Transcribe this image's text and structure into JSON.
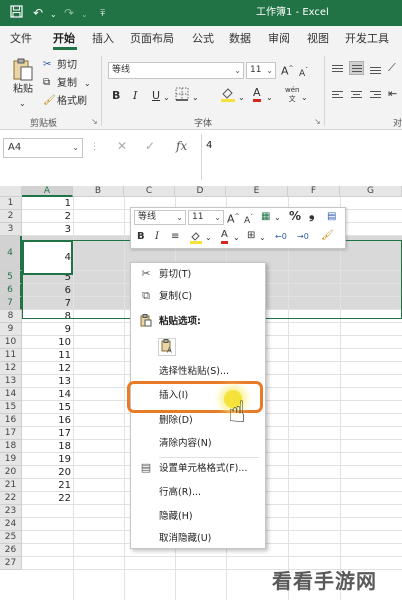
{
  "titlebar": {
    "title": "工作簿1 - Excel",
    "save_icon": "save-icon",
    "undo_icon": "undo-icon",
    "redo_icon": "redo-icon",
    "color": "#217346"
  },
  "tabs": [
    "文件",
    "开始",
    "插入",
    "页面布局",
    "公式",
    "数据",
    "审阅",
    "视图",
    "开发工具"
  ],
  "active_tab": "开始",
  "ribbon": {
    "clipboard": {
      "paste_label": "粘贴",
      "cut_label": "剪切",
      "copy_label": "复制",
      "format_painter_label": "格式刷",
      "group_label": "剪贴板"
    },
    "font": {
      "font_name": "等线",
      "font_size": "11",
      "grow": "A",
      "shrink": "A",
      "bold": "B",
      "italic": "I",
      "underline": "U",
      "font_color": "A",
      "wen": "wén",
      "group_label": "字体"
    },
    "alignment": {
      "group_label": "对"
    }
  },
  "formula_bar": {
    "name_box": "A4",
    "fx": "fx",
    "value": "4"
  },
  "columns": [
    "A",
    "B",
    "C",
    "D",
    "E",
    "F",
    "G"
  ],
  "rows": [
    {
      "n": "1",
      "a": "1"
    },
    {
      "n": "2",
      "a": "2"
    },
    {
      "n": "3",
      "a": "3"
    },
    {
      "n": "4",
      "a": "4"
    },
    {
      "n": "5",
      "a": "5"
    },
    {
      "n": "6",
      "a": "6"
    },
    {
      "n": "7",
      "a": "7"
    },
    {
      "n": "8",
      "a": "8"
    },
    {
      "n": "9",
      "a": "9"
    },
    {
      "n": "10",
      "a": "10"
    },
    {
      "n": "11",
      "a": "11"
    },
    {
      "n": "12",
      "a": "12"
    },
    {
      "n": "13",
      "a": "13"
    },
    {
      "n": "14",
      "a": "14"
    },
    {
      "n": "15",
      "a": "15"
    },
    {
      "n": "16",
      "a": "16"
    },
    {
      "n": "17",
      "a": "17"
    },
    {
      "n": "18",
      "a": "18"
    },
    {
      "n": "19",
      "a": "19"
    },
    {
      "n": "20",
      "a": "20"
    },
    {
      "n": "21",
      "a": "21"
    },
    {
      "n": "22",
      "a": "22"
    },
    {
      "n": "23",
      "a": ""
    },
    {
      "n": "24",
      "a": ""
    },
    {
      "n": "25",
      "a": ""
    },
    {
      "n": "26",
      "a": ""
    },
    {
      "n": "27",
      "a": ""
    }
  ],
  "mini_toolbar": {
    "font_name": "等线",
    "font_size": "11",
    "grow": "A",
    "shrink": "A",
    "percent": "%",
    "comma": "❟",
    "bold": "B",
    "italic": "I",
    "font_color": "A"
  },
  "context_menu": {
    "items": [
      {
        "label": "剪切(T)",
        "icon": "scissors-icon"
      },
      {
        "label": "复制(C)",
        "icon": "copy-icon"
      },
      {
        "label": "粘贴选项:",
        "icon": "paste-icon"
      },
      {
        "label": "选择性粘贴(S)...",
        "icon": ""
      },
      {
        "label": "插入(I)",
        "icon": ""
      },
      {
        "label": "删除(D)",
        "icon": ""
      },
      {
        "label": "清除内容(N)",
        "icon": ""
      },
      {
        "label": "设置单元格格式(F)...",
        "icon": "format-cells-icon"
      },
      {
        "label": "行高(R)...",
        "icon": ""
      },
      {
        "label": "隐藏(H)",
        "icon": ""
      },
      {
        "label": "取消隐藏(U)",
        "icon": ""
      }
    ],
    "highlight_color": "#e87b27"
  },
  "watermark": "看看手游网"
}
